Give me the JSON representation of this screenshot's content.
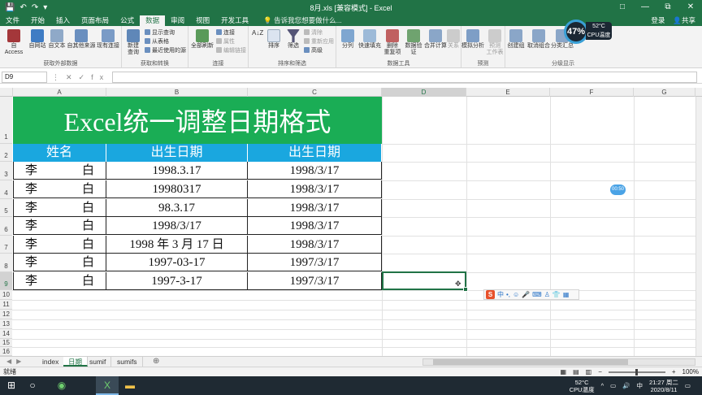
{
  "window": {
    "title": "8月.xls  [兼容模式] - Excel",
    "controls": [
      "□",
      "—",
      "⧉",
      "✕"
    ]
  },
  "ribbon_tabs": {
    "items": [
      "文件",
      "开始",
      "插入",
      "页面布局",
      "公式",
      "数据",
      "审阅",
      "视图",
      "开发工具"
    ],
    "active": "数据",
    "tell_me": "告诉我您想要做什么...",
    "login": "登录",
    "share": "共享"
  },
  "ribbon": {
    "groups": {
      "external": "获取外部数据",
      "transform": "获取和转换",
      "connections": "连接",
      "sort_filter": "排序和筛选",
      "data_tools": "数据工具",
      "forecast": "预测",
      "outline": "分级显示"
    },
    "buttons": {
      "access": "自 Access",
      "web": "自网站",
      "text": "自文本",
      "other": "自其他来源",
      "existing": "现有连接",
      "new_query": "新建\n查询",
      "show_query": "显示查询",
      "from_table": "从表格",
      "recent": "最近使用的源",
      "refresh_all": "全部刷新",
      "connections": "连接",
      "properties": "属性",
      "edit_links": "编辑链接",
      "sort": "排序",
      "filter": "筛选",
      "clear": "清除",
      "reapply": "重新应用",
      "advanced": "高级",
      "split": "分列",
      "flash_fill": "快速填充",
      "remove_dup": "删除\n重复项",
      "validation": "数据验\n证",
      "consolidate": "合并计算",
      "relations": "关系",
      "whatif": "模拟分析",
      "forecast_sheet": "预测\n工作表",
      "group": "创建组",
      "ungroup": "取消组合",
      "subtotal": "分类汇总"
    }
  },
  "cpu_widget": {
    "percent": "47%",
    "temp": "52°C",
    "label": "CPU温度"
  },
  "formula_bar": {
    "name_box": "D9",
    "controls": "⋮✕✓fx",
    "formula": ""
  },
  "grid": {
    "columns": [
      "A",
      "B",
      "C",
      "D",
      "E",
      "F",
      "G"
    ],
    "rows": [
      "1",
      "2",
      "3",
      "4",
      "5",
      "6",
      "7",
      "8",
      "9",
      "10",
      "11",
      "12",
      "13",
      "14",
      "15",
      "16"
    ],
    "title": "Excel统一调整日期格式",
    "headers": [
      "姓名",
      "出生日期",
      "出生日期"
    ],
    "data_rows": [
      {
        "name_first": "李",
        "name_last": "白",
        "original": "1998.3.17",
        "converted": "1998/3/17"
      },
      {
        "name_first": "李",
        "name_last": "白",
        "original": "19980317",
        "converted": "1998/3/17"
      },
      {
        "name_first": "李",
        "name_last": "白",
        "original": "98.3.17",
        "converted": "1998/3/17"
      },
      {
        "name_first": "李",
        "name_last": "白",
        "original": "1998/3/17",
        "converted": "1998/3/17"
      },
      {
        "name_first": "李",
        "name_last": "白",
        "original": "1998 年 3 月 17 日",
        "converted": "1998/3/17"
      },
      {
        "name_first": "李",
        "name_last": "白",
        "original": "1997-03-17",
        "converted": "1997/3/17"
      },
      {
        "name_first": "李",
        "name_last": "白",
        "original": "1997-3-17",
        "converted": "1997/3/17"
      }
    ],
    "selected_cell": "D9"
  },
  "ime_bar": {
    "logo": "S",
    "items": [
      "中",
      "•,",
      "☺",
      "🎤",
      "⌨",
      "♙",
      "👕",
      "▦"
    ]
  },
  "bubble": "00:50",
  "sheets": {
    "tabs": [
      "index",
      "日期",
      "sumif",
      "sumifs"
    ],
    "active": "日期",
    "nav": "◀▶",
    "add": "⊕"
  },
  "status": {
    "left": "就绪",
    "zoom": "100%",
    "minus": "−",
    "plus": "+"
  },
  "taskbar": {
    "temp": "52°C",
    "temp_label": "CPU温度",
    "ime": "中",
    "time": "21:27 周二",
    "date": "2020/8/11",
    "tray_icons": [
      "^",
      "▭",
      "🔊"
    ]
  },
  "colors": {
    "excel_green": "#217346",
    "title_fill": "#1aad55",
    "header_fill": "#1aa7df"
  }
}
